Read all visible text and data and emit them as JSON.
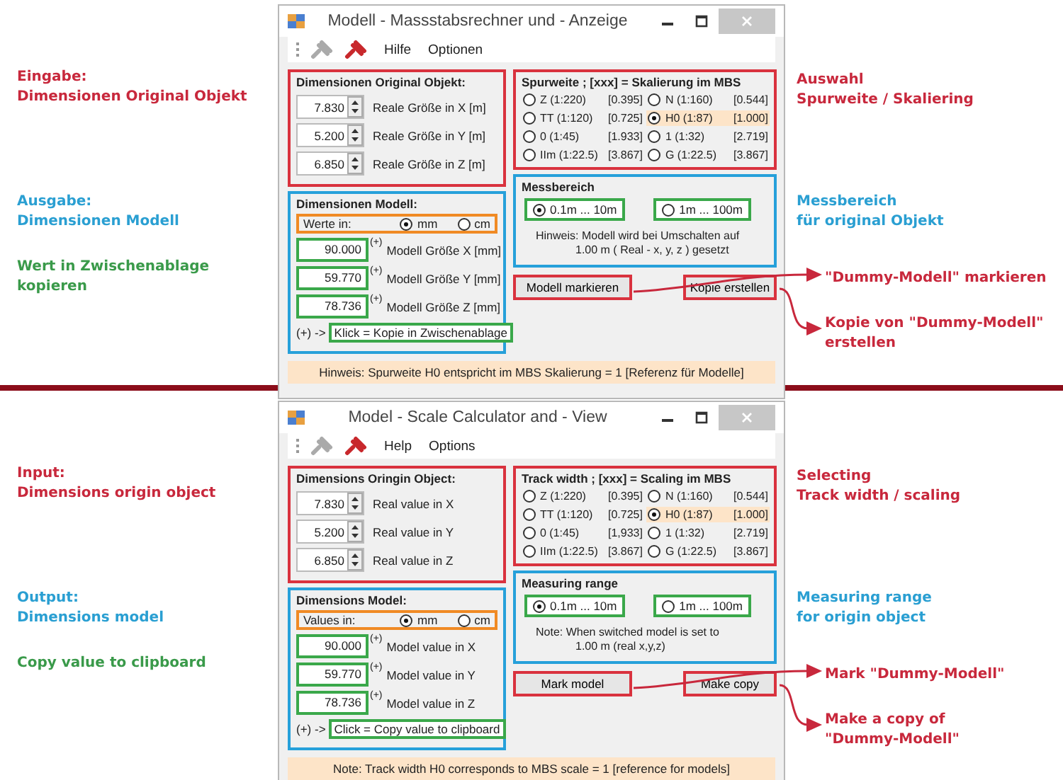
{
  "panels": [
    {
      "window": {
        "title": "Modell - Massstabsrechner und - Anzeige",
        "menu": [
          "Hilfe",
          "Optionen"
        ],
        "original": {
          "title": "Dimensionen Original Objekt:",
          "inputs": [
            {
              "value": "7.830",
              "label": "Reale Größe in X [m]"
            },
            {
              "value": "5.200",
              "label": "Reale Größe in Y [m]"
            },
            {
              "value": "6.850",
              "label": "Reale Größe in Z [m]"
            }
          ]
        },
        "model": {
          "title": "Dimensionen Modell:",
          "units_label": "Werte in:",
          "units": [
            {
              "label": "mm",
              "selected": true
            },
            {
              "label": "cm",
              "selected": false
            }
          ],
          "outputs": [
            {
              "value": "90.000",
              "mark": "(+)",
              "label": "Modell Größe X [mm]"
            },
            {
              "value": "59.770",
              "mark": "(+)",
              "label": "Modell Größe Y [mm]"
            },
            {
              "value": "78.736",
              "mark": "(+)",
              "label": "Modell Größe Z [mm]"
            }
          ],
          "copy_prefix": "(+) ->",
          "copy_hint": "Klick = Kopie in Zwischenablage"
        },
        "gauge": {
          "title": "Spurweite  ; [xxx] = Skalierung im MBS",
          "options": [
            {
              "name": "Z (1:220)",
              "scale": "[0.395]",
              "selected": false
            },
            {
              "name": "N (1:160)",
              "scale": "[0.544]",
              "selected": false
            },
            {
              "name": "TT (1:120)",
              "scale": "[0.725]",
              "selected": false
            },
            {
              "name": "H0 (1:87)",
              "scale": "[1.000]",
              "selected": true
            },
            {
              "name": "0 (1:45)",
              "scale": "[1.933]",
              "selected": false
            },
            {
              "name": "1 (1:32)",
              "scale": "[2.719]",
              "selected": false
            },
            {
              "name": "IIm (1:22.5)",
              "scale": "[3.867]",
              "selected": false
            },
            {
              "name": "G (1:22.5)",
              "scale": "[3.867]",
              "selected": false
            }
          ]
        },
        "range": {
          "title": "Messbereich",
          "options": [
            {
              "label": "0.1m ... 10m",
              "selected": true
            },
            {
              "label": "1m ... 100m",
              "selected": false
            }
          ],
          "note": [
            "Hinweis: Modell wird bei Umschalten auf",
            "1.00 m  ( Real - x, y, z ) gesetzt"
          ]
        },
        "buttons": [
          "Modell markieren",
          "Kopie erstellen"
        ],
        "hint": "Hinweis: Spurweite H0 entspricht im MBS Skalierung = 1 [Referenz für Modelle]"
      },
      "annotations_left": [
        {
          "lines": [
            "Eingabe:",
            "Dimensionen Original Objekt"
          ],
          "color": "#c8283c"
        },
        {
          "lines": [
            "Ausgabe:",
            "Dimensionen Modell"
          ],
          "color": "#2a9fd2"
        },
        {
          "lines": [
            "Wert in Zwischenablage",
            "kopieren"
          ],
          "color": "#3a9a4a"
        }
      ],
      "annotations_right": [
        {
          "lines": [
            "Auswahl",
            "Spurweite / Skaliering"
          ],
          "color": "#c8283c",
          "kind": "note"
        },
        {
          "lines": [
            "Messbereich",
            "für original Objekt"
          ],
          "color": "#2a9fd2",
          "kind": "note"
        },
        {
          "lines": [
            "\"Dummy-Modell\" markieren"
          ],
          "color": "#c8283c",
          "kind": "arrow-note"
        },
        {
          "lines": [
            "Kopie von \"Dummy-Modell\"",
            "erstellen"
          ],
          "color": "#c8283c",
          "kind": "arrow-note"
        }
      ]
    },
    {
      "window": {
        "title": "Model - Scale Calculator and - View",
        "menu": [
          "Help",
          "Options"
        ],
        "original": {
          "title": "Dimensions Oringin Object:",
          "inputs": [
            {
              "value": "7.830",
              "label": "Real value in X"
            },
            {
              "value": "5.200",
              "label": "Real value in Y"
            },
            {
              "value": "6.850",
              "label": "Real value in Z"
            }
          ]
        },
        "model": {
          "title": "Dimensions Model:",
          "units_label": "Values in:",
          "units": [
            {
              "label": "mm",
              "selected": true
            },
            {
              "label": "cm",
              "selected": false
            }
          ],
          "outputs": [
            {
              "value": "90.000",
              "mark": "(+)",
              "label": "Model value in X"
            },
            {
              "value": "59.770",
              "mark": "(+)",
              "label": "Model value in Y"
            },
            {
              "value": "78.736",
              "mark": "(+)",
              "label": "Model value in Z"
            }
          ],
          "copy_prefix": "(+) ->",
          "copy_hint": "Click = Copy value to clipboard"
        },
        "gauge": {
          "title": "Track width  ; [xxx] = Scaling im MBS",
          "options": [
            {
              "name": "Z (1:220)",
              "scale": "[0.395]",
              "selected": false
            },
            {
              "name": "N (1:160)",
              "scale": "[0.544]",
              "selected": false
            },
            {
              "name": "TT (1:120)",
              "scale": "[0.725]",
              "selected": false
            },
            {
              "name": "H0 (1:87)",
              "scale": "[1.000]",
              "selected": true
            },
            {
              "name": "0 (1:45)",
              "scale": "[1,933]",
              "selected": false
            },
            {
              "name": "1 (1:32)",
              "scale": "[2.719]",
              "selected": false
            },
            {
              "name": "IIm (1:22.5)",
              "scale": "[3.867]",
              "selected": false
            },
            {
              "name": "G (1:22.5)",
              "scale": "[3.867]",
              "selected": false
            }
          ]
        },
        "range": {
          "title": "Measuring range",
          "options": [
            {
              "label": "0.1m ... 10m",
              "selected": true
            },
            {
              "label": "1m ... 100m",
              "selected": false
            }
          ],
          "note": [
            "Note: When switched model is set to",
            "1.00 m (real x,y,z)"
          ]
        },
        "buttons": [
          "Mark model",
          "Make copy"
        ],
        "hint": "Note: Track width H0 corresponds to MBS scale = 1 [reference for models]"
      },
      "annotations_left": [
        {
          "lines": [
            "Input:",
            "Dimensions origin object"
          ],
          "color": "#c8283c"
        },
        {
          "lines": [
            "Output:",
            "Dimensions model"
          ],
          "color": "#2a9fd2"
        },
        {
          "lines": [
            "Copy value to clipboard"
          ],
          "color": "#3a9a4a"
        }
      ],
      "annotations_right": [
        {
          "lines": [
            "Selecting",
            "Track width / scaling"
          ],
          "color": "#c8283c",
          "kind": "note"
        },
        {
          "lines": [
            "Measuring range",
            "for origin object"
          ],
          "color": "#2a9fd2",
          "kind": "note"
        },
        {
          "lines": [
            "Mark \"Dummy-Modell\""
          ],
          "color": "#c8283c",
          "kind": "arrow-note"
        },
        {
          "lines": [
            "Make a copy of",
            "\"Dummy-Modell\""
          ],
          "color": "#c8283c",
          "kind": "arrow-note"
        }
      ]
    }
  ]
}
